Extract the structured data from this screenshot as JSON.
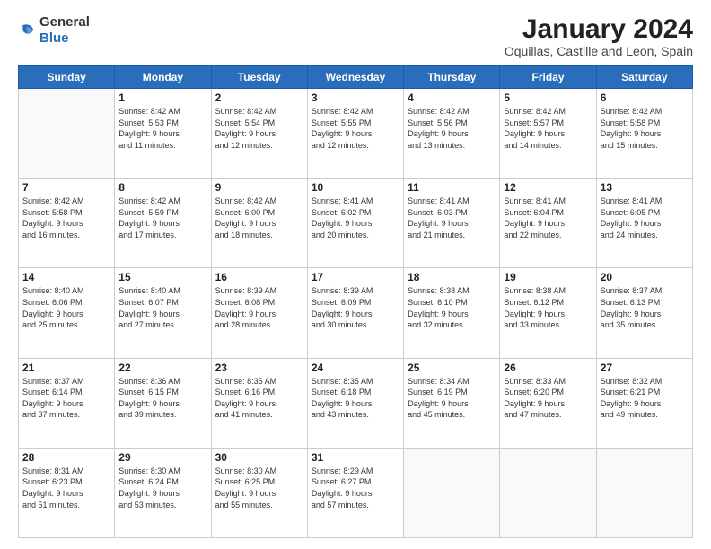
{
  "logo": {
    "general": "General",
    "blue": "Blue"
  },
  "header": {
    "title": "January 2024",
    "subtitle": "Oquillas, Castille and Leon, Spain"
  },
  "weekdays": [
    "Sunday",
    "Monday",
    "Tuesday",
    "Wednesday",
    "Thursday",
    "Friday",
    "Saturday"
  ],
  "weeks": [
    [
      {
        "day": "",
        "sunrise": "",
        "sunset": "",
        "daylight": ""
      },
      {
        "day": "1",
        "sunrise": "Sunrise: 8:42 AM",
        "sunset": "Sunset: 5:53 PM",
        "daylight": "Daylight: 9 hours and 11 minutes."
      },
      {
        "day": "2",
        "sunrise": "Sunrise: 8:42 AM",
        "sunset": "Sunset: 5:54 PM",
        "daylight": "Daylight: 9 hours and 12 minutes."
      },
      {
        "day": "3",
        "sunrise": "Sunrise: 8:42 AM",
        "sunset": "Sunset: 5:55 PM",
        "daylight": "Daylight: 9 hours and 12 minutes."
      },
      {
        "day": "4",
        "sunrise": "Sunrise: 8:42 AM",
        "sunset": "Sunset: 5:56 PM",
        "daylight": "Daylight: 9 hours and 13 minutes."
      },
      {
        "day": "5",
        "sunrise": "Sunrise: 8:42 AM",
        "sunset": "Sunset: 5:57 PM",
        "daylight": "Daylight: 9 hours and 14 minutes."
      },
      {
        "day": "6",
        "sunrise": "Sunrise: 8:42 AM",
        "sunset": "Sunset: 5:58 PM",
        "daylight": "Daylight: 9 hours and 15 minutes."
      }
    ],
    [
      {
        "day": "7",
        "sunrise": "Sunrise: 8:42 AM",
        "sunset": "Sunset: 5:58 PM",
        "daylight": "Daylight: 9 hours and 16 minutes."
      },
      {
        "day": "8",
        "sunrise": "Sunrise: 8:42 AM",
        "sunset": "Sunset: 5:59 PM",
        "daylight": "Daylight: 9 hours and 17 minutes."
      },
      {
        "day": "9",
        "sunrise": "Sunrise: 8:42 AM",
        "sunset": "Sunset: 6:00 PM",
        "daylight": "Daylight: 9 hours and 18 minutes."
      },
      {
        "day": "10",
        "sunrise": "Sunrise: 8:41 AM",
        "sunset": "Sunset: 6:02 PM",
        "daylight": "Daylight: 9 hours and 20 minutes."
      },
      {
        "day": "11",
        "sunrise": "Sunrise: 8:41 AM",
        "sunset": "Sunset: 6:03 PM",
        "daylight": "Daylight: 9 hours and 21 minutes."
      },
      {
        "day": "12",
        "sunrise": "Sunrise: 8:41 AM",
        "sunset": "Sunset: 6:04 PM",
        "daylight": "Daylight: 9 hours and 22 minutes."
      },
      {
        "day": "13",
        "sunrise": "Sunrise: 8:41 AM",
        "sunset": "Sunset: 6:05 PM",
        "daylight": "Daylight: 9 hours and 24 minutes."
      }
    ],
    [
      {
        "day": "14",
        "sunrise": "Sunrise: 8:40 AM",
        "sunset": "Sunset: 6:06 PM",
        "daylight": "Daylight: 9 hours and 25 minutes."
      },
      {
        "day": "15",
        "sunrise": "Sunrise: 8:40 AM",
        "sunset": "Sunset: 6:07 PM",
        "daylight": "Daylight: 9 hours and 27 minutes."
      },
      {
        "day": "16",
        "sunrise": "Sunrise: 8:39 AM",
        "sunset": "Sunset: 6:08 PM",
        "daylight": "Daylight: 9 hours and 28 minutes."
      },
      {
        "day": "17",
        "sunrise": "Sunrise: 8:39 AM",
        "sunset": "Sunset: 6:09 PM",
        "daylight": "Daylight: 9 hours and 30 minutes."
      },
      {
        "day": "18",
        "sunrise": "Sunrise: 8:38 AM",
        "sunset": "Sunset: 6:10 PM",
        "daylight": "Daylight: 9 hours and 32 minutes."
      },
      {
        "day": "19",
        "sunrise": "Sunrise: 8:38 AM",
        "sunset": "Sunset: 6:12 PM",
        "daylight": "Daylight: 9 hours and 33 minutes."
      },
      {
        "day": "20",
        "sunrise": "Sunrise: 8:37 AM",
        "sunset": "Sunset: 6:13 PM",
        "daylight": "Daylight: 9 hours and 35 minutes."
      }
    ],
    [
      {
        "day": "21",
        "sunrise": "Sunrise: 8:37 AM",
        "sunset": "Sunset: 6:14 PM",
        "daylight": "Daylight: 9 hours and 37 minutes."
      },
      {
        "day": "22",
        "sunrise": "Sunrise: 8:36 AM",
        "sunset": "Sunset: 6:15 PM",
        "daylight": "Daylight: 9 hours and 39 minutes."
      },
      {
        "day": "23",
        "sunrise": "Sunrise: 8:35 AM",
        "sunset": "Sunset: 6:16 PM",
        "daylight": "Daylight: 9 hours and 41 minutes."
      },
      {
        "day": "24",
        "sunrise": "Sunrise: 8:35 AM",
        "sunset": "Sunset: 6:18 PM",
        "daylight": "Daylight: 9 hours and 43 minutes."
      },
      {
        "day": "25",
        "sunrise": "Sunrise: 8:34 AM",
        "sunset": "Sunset: 6:19 PM",
        "daylight": "Daylight: 9 hours and 45 minutes."
      },
      {
        "day": "26",
        "sunrise": "Sunrise: 8:33 AM",
        "sunset": "Sunset: 6:20 PM",
        "daylight": "Daylight: 9 hours and 47 minutes."
      },
      {
        "day": "27",
        "sunrise": "Sunrise: 8:32 AM",
        "sunset": "Sunset: 6:21 PM",
        "daylight": "Daylight: 9 hours and 49 minutes."
      }
    ],
    [
      {
        "day": "28",
        "sunrise": "Sunrise: 8:31 AM",
        "sunset": "Sunset: 6:23 PM",
        "daylight": "Daylight: 9 hours and 51 minutes."
      },
      {
        "day": "29",
        "sunrise": "Sunrise: 8:30 AM",
        "sunset": "Sunset: 6:24 PM",
        "daylight": "Daylight: 9 hours and 53 minutes."
      },
      {
        "day": "30",
        "sunrise": "Sunrise: 8:30 AM",
        "sunset": "Sunset: 6:25 PM",
        "daylight": "Daylight: 9 hours and 55 minutes."
      },
      {
        "day": "31",
        "sunrise": "Sunrise: 8:29 AM",
        "sunset": "Sunset: 6:27 PM",
        "daylight": "Daylight: 9 hours and 57 minutes."
      },
      {
        "day": "",
        "sunrise": "",
        "sunset": "",
        "daylight": ""
      },
      {
        "day": "",
        "sunrise": "",
        "sunset": "",
        "daylight": ""
      },
      {
        "day": "",
        "sunrise": "",
        "sunset": "",
        "daylight": ""
      }
    ]
  ]
}
